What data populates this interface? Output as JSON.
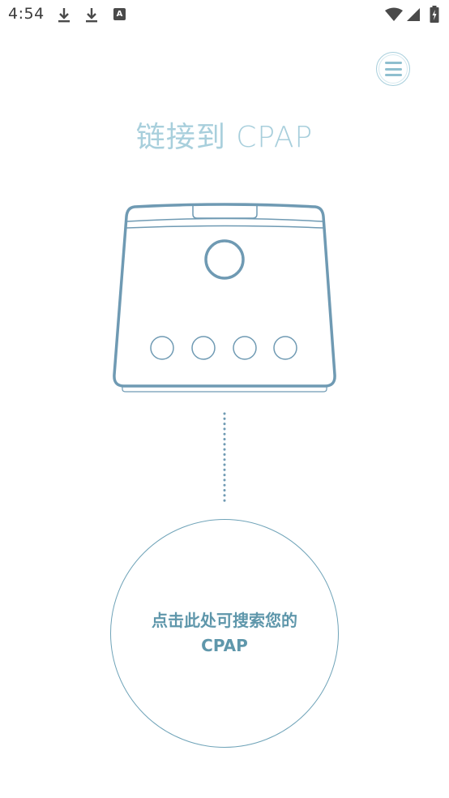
{
  "status_bar": {
    "time": "4:54",
    "a_icon_label": "A",
    "icons": [
      "download-icon",
      "download-icon",
      "a-icon",
      "wifi-icon",
      "signal-icon",
      "battery-charging-icon"
    ]
  },
  "header": {
    "menu_icon": "menu-icon"
  },
  "title": "链接到 CPAP",
  "device": {
    "icon": "cpap-device-illustration"
  },
  "search_button": {
    "line1": "点击此处可搜索您的",
    "line2": "CPAP"
  },
  "colors": {
    "title": "#a8cfdc",
    "device_stroke": "#6f9ab3",
    "search_circle": "#6fa3b8",
    "search_text": "#5f97ab",
    "menu_border": "#a8cfdc"
  }
}
